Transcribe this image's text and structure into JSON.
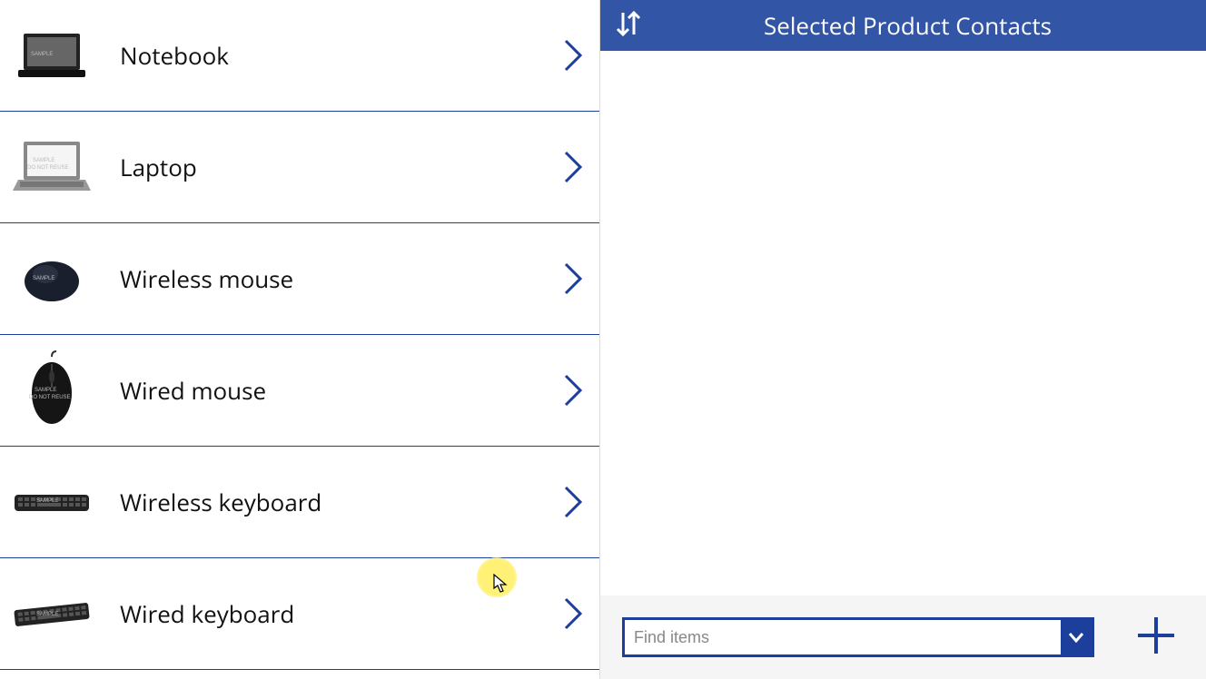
{
  "left": {
    "products": [
      {
        "label": "Notebook",
        "icon": "laptop-dark"
      },
      {
        "label": "Laptop",
        "icon": "laptop-light"
      },
      {
        "label": "Wireless mouse",
        "icon": "mouse-dark"
      },
      {
        "label": "Wired mouse",
        "icon": "mouse-wired"
      },
      {
        "label": "Wireless keyboard",
        "icon": "keyboard"
      },
      {
        "label": "Wired keyboard",
        "icon": "keyboard"
      }
    ]
  },
  "right": {
    "title": "Selected Product Contacts",
    "find_placeholder": "Find items"
  },
  "colors": {
    "accent": "#1d3f9c",
    "header": "#3355a5"
  }
}
